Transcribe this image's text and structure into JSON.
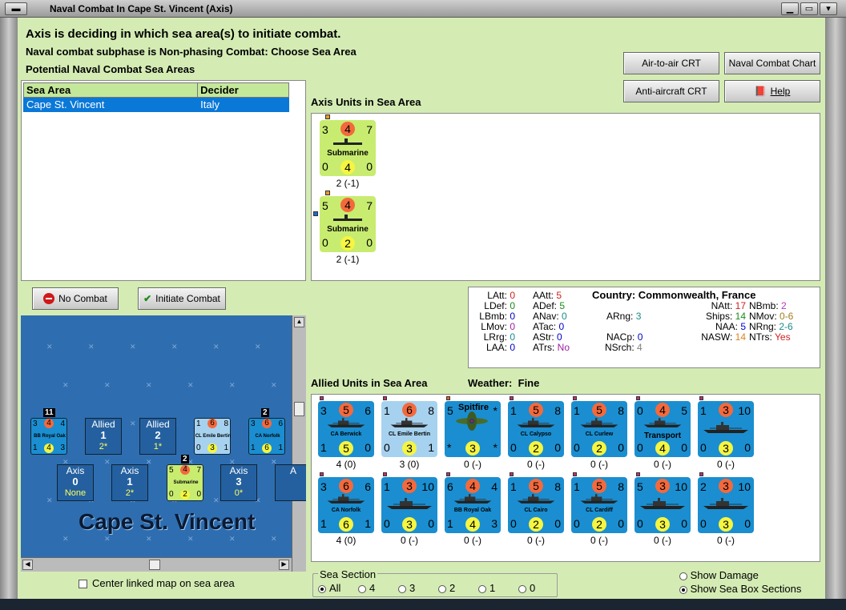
{
  "window": {
    "title": "Naval Combat In Cape St. Vincent (Axis)"
  },
  "status": {
    "line1": "Axis is deciding in which sea area(s) to initiate combat.",
    "line2": "Naval combat subphase is Non-phasing Combat: Choose Sea Area",
    "line3": "Potential Naval Combat Sea Areas"
  },
  "sea_table": {
    "headers": [
      "Sea Area",
      "Decider"
    ],
    "rows": [
      [
        "Cape St. Vincent",
        "Italy"
      ]
    ]
  },
  "buttons": {
    "air_crt": "Air-to-air CRT",
    "naval_chart": "Naval Combat Chart",
    "aa_crt": "Anti-aircraft CRT",
    "help": "Help",
    "no_combat": "No Combat",
    "initiate": "Initiate Combat"
  },
  "axis_units": {
    "title": "Axis Units in Sea Area",
    "units": [
      {
        "tl": "3",
        "tc": "4",
        "tr": "7",
        "name": "Submarine",
        "bl": "0",
        "bc": "4",
        "br": "0",
        "caption": "2 (-1)"
      },
      {
        "tl": "5",
        "tc": "4",
        "tr": "7",
        "name": "Submarine",
        "bl": "0",
        "bc": "2",
        "br": "0",
        "caption": "2 (-1)"
      }
    ]
  },
  "stats": {
    "col1": [
      [
        "LAtt:",
        "0"
      ],
      [
        "LDef:",
        "0"
      ],
      [
        "LBmb:",
        "0"
      ],
      [
        "LMov:",
        "0"
      ],
      [
        "LRrg:",
        "0"
      ],
      [
        "LAA:",
        "0"
      ]
    ],
    "col2": [
      [
        "AAtt:",
        "5"
      ],
      [
        "ADef:",
        "5"
      ],
      [
        "ANav:",
        "0"
      ],
      [
        "ATac:",
        "0"
      ],
      [
        "AStr:",
        "0"
      ],
      [
        "ATrs:",
        "No"
      ]
    ],
    "country_label": "Country:",
    "country": "Commonwealth, France",
    "arng_l": "ARng:",
    "arng": "3",
    "nacp_l": "NACp:",
    "nacp": "0",
    "nsrch_l": "NSrch:",
    "nsrch": "4",
    "col3": [
      [
        "NAtt:",
        "17"
      ],
      [
        "Ships:",
        "14"
      ],
      [
        "NAA:",
        "5"
      ],
      [
        "NASW:",
        "14"
      ]
    ],
    "col4": [
      [
        "NBmb:",
        "2"
      ],
      [
        "NMov:",
        "0-6"
      ],
      [
        "NRng:",
        "2-6"
      ],
      [
        "NTrs:",
        "Yes"
      ]
    ]
  },
  "allied": {
    "title": "Allied Units in Sea Area",
    "weather_label": "Weather:",
    "weather": "Fine",
    "units": [
      {
        "tl": "3",
        "tc": "5",
        "tr": "6",
        "name": "CA Berwick",
        "bl": "1",
        "bc": "5",
        "br": "0",
        "caption": "4 (0)",
        "bg": "#1a8ed0"
      },
      {
        "tl": "1",
        "tc": "6",
        "tr": "8",
        "name": "CL Emile Bertin",
        "bl": "0",
        "bc": "3",
        "br": "1",
        "caption": "3 (0)",
        "bg": "#a6d2ef"
      },
      {
        "tl": "5",
        "tc": "",
        "tr": "*",
        "name": "Spitfire",
        "bl": "*",
        "bc": "3",
        "br": "*",
        "caption": "0 (-)",
        "bg": "#1a8ed0"
      },
      {
        "tl": "1",
        "tc": "5",
        "tr": "8",
        "name": "CL Calypso",
        "bl": "0",
        "bc": "2",
        "br": "0",
        "caption": "0 (-)",
        "bg": "#1a8ed0"
      },
      {
        "tl": "1",
        "tc": "5",
        "tr": "8",
        "name": "CL Curlew",
        "bl": "0",
        "bc": "2",
        "br": "0",
        "caption": "0 (-)",
        "bg": "#1a8ed0"
      },
      {
        "tl": "0",
        "tc": "4",
        "tr": "5",
        "name": "Transport",
        "bl": "0",
        "bc": "4",
        "br": "0",
        "caption": "0 (-)",
        "bg": "#1a8ed0"
      },
      {
        "tl": "1",
        "tc": "3",
        "tr": "10",
        "name": "",
        "bl": "0",
        "bc": "3",
        "br": "0",
        "caption": "0 (-)",
        "bg": "#1a8ed0"
      },
      {
        "tl": "3",
        "tc": "6",
        "tr": "6",
        "name": "CA Norfolk",
        "bl": "1",
        "bc": "6",
        "br": "1",
        "caption": "4 (0)",
        "bg": "#1a8ed0"
      },
      {
        "tl": "1",
        "tc": "3",
        "tr": "10",
        "name": "",
        "bl": "0",
        "bc": "3",
        "br": "0",
        "caption": "0 (-)",
        "bg": "#1a8ed0"
      },
      {
        "tl": "6",
        "tc": "4",
        "tr": "4",
        "name": "BB Royal Oak",
        "bl": "1",
        "bc": "4",
        "br": "3",
        "caption": "0 (-)",
        "bg": "#1a8ed0"
      },
      {
        "tl": "1",
        "tc": "5",
        "tr": "8",
        "name": "CL Cairo",
        "bl": "0",
        "bc": "2",
        "br": "0",
        "caption": "0 (-)",
        "bg": "#1a8ed0"
      },
      {
        "tl": "1",
        "tc": "5",
        "tr": "8",
        "name": "CL Cardiff",
        "bl": "0",
        "bc": "2",
        "br": "0",
        "caption": "0 (-)",
        "bg": "#1a8ed0"
      },
      {
        "tl": "5",
        "tc": "3",
        "tr": "10",
        "name": "",
        "bl": "0",
        "bc": "3",
        "br": "0",
        "caption": "0 (-)",
        "bg": "#1a8ed0"
      },
      {
        "tl": "2",
        "tc": "3",
        "tr": "10",
        "name": "",
        "bl": "0",
        "bc": "3",
        "br": "0",
        "caption": "0 (-)",
        "bg": "#1a8ed0"
      }
    ]
  },
  "map": {
    "name": "Cape St. Vincent",
    "allied_boxes": [
      {
        "label": "Allied",
        "value": "1",
        "sub": "2*"
      },
      {
        "label": "Allied",
        "value": "2",
        "sub": "1*"
      }
    ],
    "axis_boxes": [
      {
        "label": "Axis",
        "value": "0",
        "sub": "None"
      },
      {
        "label": "Axis",
        "value": "1",
        "sub": "2*"
      },
      {
        "label": "Axis",
        "value": "3",
        "sub": "0*"
      },
      {
        "label": "A"
      }
    ],
    "stack1": "11",
    "stack2": "2",
    "stack3": "2",
    "mini": [
      {
        "tl": "3",
        "tc": "4",
        "tr": "4",
        "name": "BB Royal Oak",
        "bl": "1",
        "bc": "4",
        "br": "3"
      },
      {
        "tl": "1",
        "tc": "6",
        "tr": "8",
        "name": "CL Emile Bertin",
        "bl": "0",
        "bc": "3",
        "br": "1"
      },
      {
        "tl": "3",
        "tc": "6",
        "tr": "6",
        "name": "CA Norfolk",
        "bl": "1",
        "bc": "6",
        "br": "1"
      },
      {
        "tl": "5",
        "tc": "4",
        "tr": "7",
        "name": "Submarine",
        "bl": "0",
        "bc": "2",
        "br": "0"
      }
    ]
  },
  "center_map": "Center linked map on sea area",
  "sea_section": {
    "title": "Sea Section",
    "options": [
      "All",
      "4",
      "3",
      "2",
      "1",
      "0"
    ]
  },
  "show_damage": "Show Damage",
  "show_sections": "Show Sea Box Sections"
}
